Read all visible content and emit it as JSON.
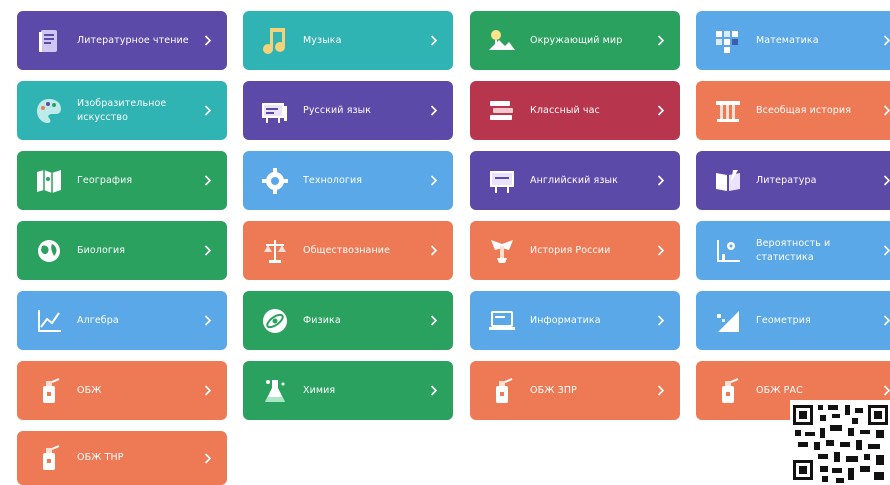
{
  "subjects": [
    {
      "label": "Литературное чтение",
      "color": "#5b4aa8",
      "icon": "book-icon"
    },
    {
      "label": "Музыка",
      "color": "#2fb3b3",
      "icon": "music-note-icon"
    },
    {
      "label": "Окружающий мир",
      "color": "#2aa15e",
      "icon": "landscape-icon"
    },
    {
      "label": "Математика",
      "color": "#5aa8e8",
      "icon": "math-blocks-icon"
    },
    {
      "label": "Изобразительное искусство",
      "color": "#2fb3b3",
      "icon": "palette-icon"
    },
    {
      "label": "Русский язык",
      "color": "#5b4aa8",
      "icon": "alphabet-board-icon"
    },
    {
      "label": "Классный час",
      "color": "#b8364d",
      "icon": "book-stack-icon"
    },
    {
      "label": "Всеобщая история",
      "color": "#ee7a55",
      "icon": "column-icon"
    },
    {
      "label": "География",
      "color": "#2aa15e",
      "icon": "map-icon"
    },
    {
      "label": "Технология",
      "color": "#5aa8e8",
      "icon": "gear-icon"
    },
    {
      "label": "Английский язык",
      "color": "#5b4aa8",
      "icon": "az-board-icon"
    },
    {
      "label": "Литература",
      "color": "#5b4aa8",
      "icon": "open-book-icon"
    },
    {
      "label": "Биология",
      "color": "#2aa15e",
      "icon": "leaf-globe-icon"
    },
    {
      "label": "Обществознание",
      "color": "#ee7a55",
      "icon": "scales-icon"
    },
    {
      "label": "История России",
      "color": "#ee7a55",
      "icon": "eagle-icon"
    },
    {
      "label": "Вероятность и статистика",
      "color": "#5aa8e8",
      "icon": "graph-icon"
    },
    {
      "label": "Алгебра",
      "color": "#5aa8e8",
      "icon": "chart-axes-icon"
    },
    {
      "label": "Физика",
      "color": "#2aa15e",
      "icon": "atom-icon"
    },
    {
      "label": "Информатика",
      "color": "#5aa8e8",
      "icon": "laptop-icon"
    },
    {
      "label": "Геометрия",
      "color": "#5aa8e8",
      "icon": "triangle-icon"
    },
    {
      "label": "ОБЖ",
      "color": "#ee7a55",
      "icon": "fire-extinguisher-icon"
    },
    {
      "label": "Химия",
      "color": "#2aa15e",
      "icon": "flask-icon"
    },
    {
      "label": "ОБЖ ЗПР",
      "color": "#ee7a55",
      "icon": "fire-extinguisher-icon"
    },
    {
      "label": "ОБЖ РАС",
      "color": "#ee7a55",
      "icon": "fire-extinguisher-icon"
    },
    {
      "label": "ОБЖ ТНР",
      "color": "#ee7a55",
      "icon": "fire-extinguisher-icon"
    }
  ],
  "qr_code": {
    "icon": "qr-code-icon"
  }
}
